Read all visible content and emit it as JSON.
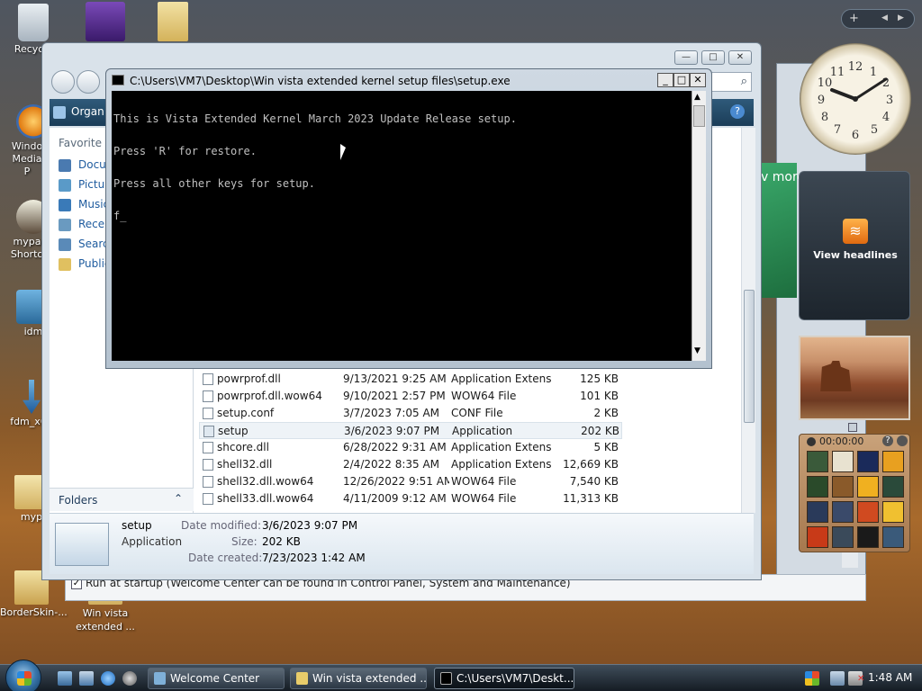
{
  "desktop": {
    "icons": [
      {
        "label": "Recycle"
      },
      {
        "label": "Windo Media P"
      },
      {
        "label": "mypa Shorto"
      },
      {
        "label": "idm"
      },
      {
        "label": "fdm_x64"
      },
      {
        "label": "myp"
      },
      {
        "label": "BorderSkin-..."
      },
      {
        "label": "Win vista extended ..."
      }
    ]
  },
  "explorer": {
    "toolbar": {
      "organize": "Organ"
    },
    "sidebar": {
      "heading": "Favorite L",
      "items": [
        "Docu",
        "Pictur",
        "Music",
        "Recen",
        "Search",
        "Public"
      ],
      "folders_label": "Folders"
    },
    "files": [
      {
        "name": "powrprof.dll",
        "date": "9/13/2021 9:25 AM",
        "type": "Application Extens...",
        "size": "125 KB"
      },
      {
        "name": "powrprof.dll.wow64",
        "date": "9/10/2021 2:57 PM",
        "type": "WOW64 File",
        "size": "101 KB"
      },
      {
        "name": "setup.conf",
        "date": "3/7/2023 7:05 AM",
        "type": "CONF File",
        "size": "2 KB"
      },
      {
        "name": "setup",
        "date": "3/6/2023 9:07 PM",
        "type": "Application",
        "size": "202 KB"
      },
      {
        "name": "shcore.dll",
        "date": "6/28/2022 9:31 AM",
        "type": "Application Extens...",
        "size": "5 KB"
      },
      {
        "name": "shell32.dll",
        "date": "2/4/2022 8:35 AM",
        "type": "Application Extens...",
        "size": "12,669 KB"
      },
      {
        "name": "shell32.dll.wow64",
        "date": "12/26/2022 9:51 AM",
        "type": "WOW64 File",
        "size": "7,540 KB"
      },
      {
        "name": "shell33.dll.wow64",
        "date": "4/11/2009 9:12 AM",
        "type": "WOW64 File",
        "size": "11,313 KB"
      }
    ],
    "details": {
      "name": "setup",
      "kind": "Application",
      "modified_label": "Date modified:",
      "modified_value": "3/6/2023 9:07 PM",
      "size_label": "Size:",
      "size_value": "202 KB",
      "created_label": "Date created:",
      "created_value": "7/23/2023 1:42 AM"
    }
  },
  "welcome": {
    "banner_text": "v more",
    "startup_checkbox": "Run at startup (Welcome Center can be found in Control Panel, System and Maintenance)"
  },
  "console": {
    "title": "C:\\Users\\VM7\\Desktop\\Win vista extended kernel setup files\\setup.exe",
    "lines": [
      "This is Vista Extended Kernel March 2023 Update Release setup.",
      "Press 'R' for restore.",
      "Press all other keys for setup.",
      "f"
    ]
  },
  "gadgets": {
    "rss_label": "View headlines",
    "puzzle_timer": "00:00:00",
    "puzzle_help": "?"
  },
  "taskbar": {
    "tasks": [
      {
        "label": "Welcome Center"
      },
      {
        "label": "Win vista extended ..."
      },
      {
        "label": "C:\\Users\\VM7\\Deskt..."
      }
    ],
    "clock": "1:48 AM"
  },
  "colors": {
    "console_bg": "#000000",
    "console_text": "#c0c0c0",
    "taskbar_bg": "#1c2530",
    "link_blue": "#1e5b9e"
  }
}
